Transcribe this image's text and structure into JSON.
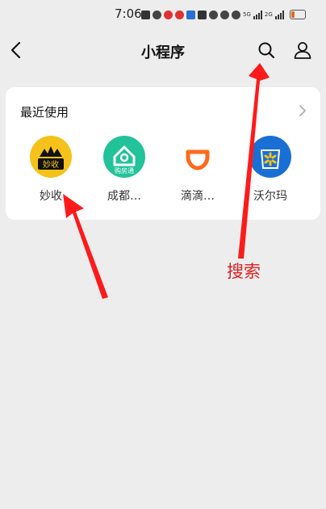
{
  "status": {
    "time": "7:06",
    "net_a": "5G",
    "net_b": "2G"
  },
  "header": {
    "title": "小程序"
  },
  "recent": {
    "title": "最近使用",
    "apps": [
      {
        "label": "妙收",
        "icon_text": "妙收",
        "color": "#f5c21a"
      },
      {
        "label": "成都…",
        "icon_text": "购房通",
        "color": "#22c29a"
      },
      {
        "label": "滴滴…",
        "icon_text": "",
        "color": "#ff6a1a"
      },
      {
        "label": "沃尔玛",
        "icon_text": "",
        "color": "#1a6fd4"
      }
    ]
  },
  "annotation": {
    "text": "搜索",
    "color": "#e02020"
  }
}
